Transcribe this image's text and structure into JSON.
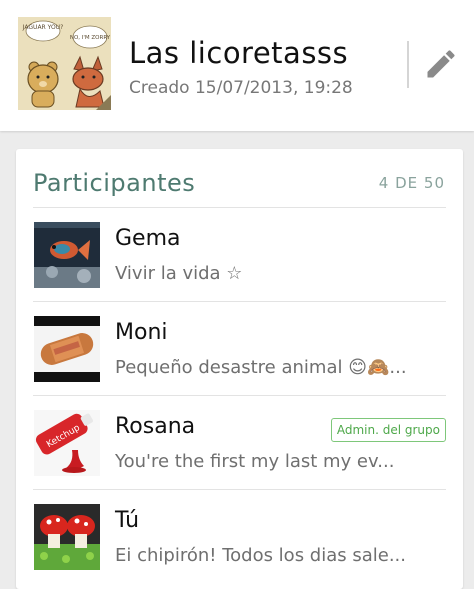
{
  "group": {
    "title": "Las licoretasss",
    "created": "Creado 15/07/2013, 19:28",
    "avatar_icon": "cartoon-group-avatar",
    "avatar_bubble_left": "JAGUAR YOU?",
    "avatar_bubble_right": "NO, I'M ZORRY"
  },
  "participants": {
    "title": "Participantes",
    "count": "4 DE 50",
    "items": [
      {
        "name": "Gema",
        "status": "Vivir la vida ☆",
        "avatar_icon": "fish-photo-icon",
        "admin": ""
      },
      {
        "name": "Moni",
        "status": "Pequeño desastre animal 😊🙈...",
        "avatar_icon": "sausage-photo-icon",
        "admin": ""
      },
      {
        "name": "Rosana",
        "status": "You're the first my last my ev...",
        "avatar_icon": "ketchup-photo-icon",
        "admin": "Admin. del grupo"
      },
      {
        "name": "Tú",
        "status": "Ei chipirón! Todos los dias sale...",
        "avatar_icon": "mushroom-food-photo-icon",
        "admin": ""
      }
    ]
  },
  "colors": {
    "accent": "#4e7a70",
    "admin_badge": "#4ea84a",
    "background": "#ececec"
  }
}
